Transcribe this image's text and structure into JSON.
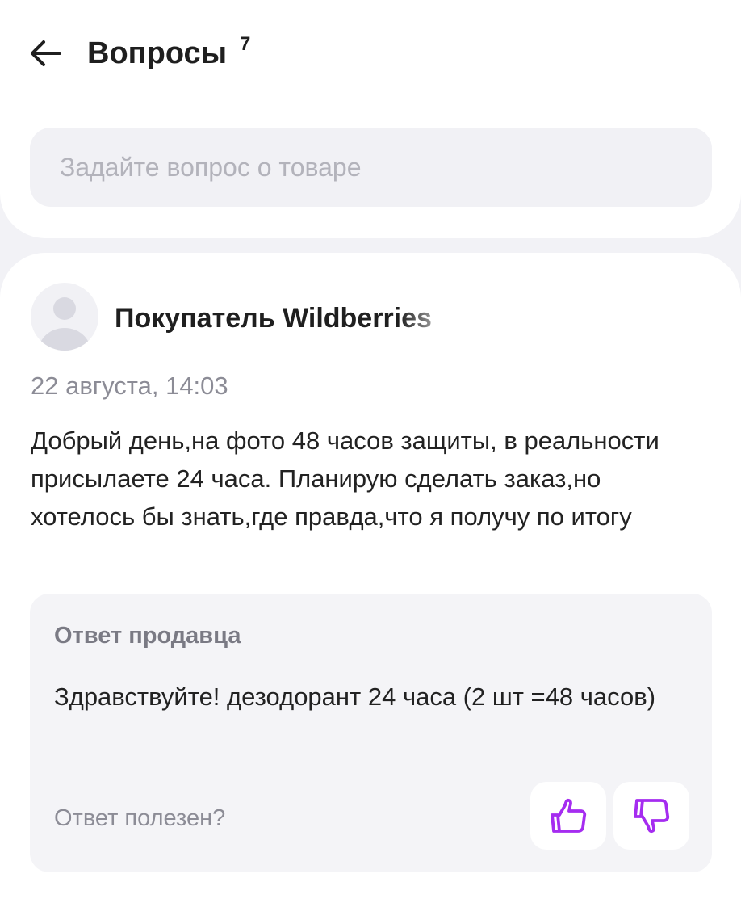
{
  "header": {
    "title": "Вопросы",
    "count": "7"
  },
  "ask": {
    "placeholder": "Задайте вопрос о товаре"
  },
  "question": {
    "author": "Покупатель Wildberries",
    "date": "22 августа, 14:03",
    "text": "Добрый день,на фото 48 часов защиты, в реальности присылаете 24 часа. Планирую сделать заказ,но хотелось бы знать,где правда,что я получу по итогу",
    "answer": {
      "title": "Ответ продавца",
      "text": "Здравствуйте! дезодорант 24 часа (2 шт =48 часов)",
      "helpful_label": "Ответ полезен?"
    }
  },
  "icons": {
    "back": "arrow-left-icon",
    "avatar": "user-icon",
    "like": "thumbs-up-icon",
    "dislike": "thumbs-down-icon"
  },
  "colors": {
    "accent": "#a52cf0",
    "background": "#f2f2f6",
    "card": "#ffffff",
    "input_bg": "#f1f1f5",
    "muted_text": "#8c8c96"
  }
}
